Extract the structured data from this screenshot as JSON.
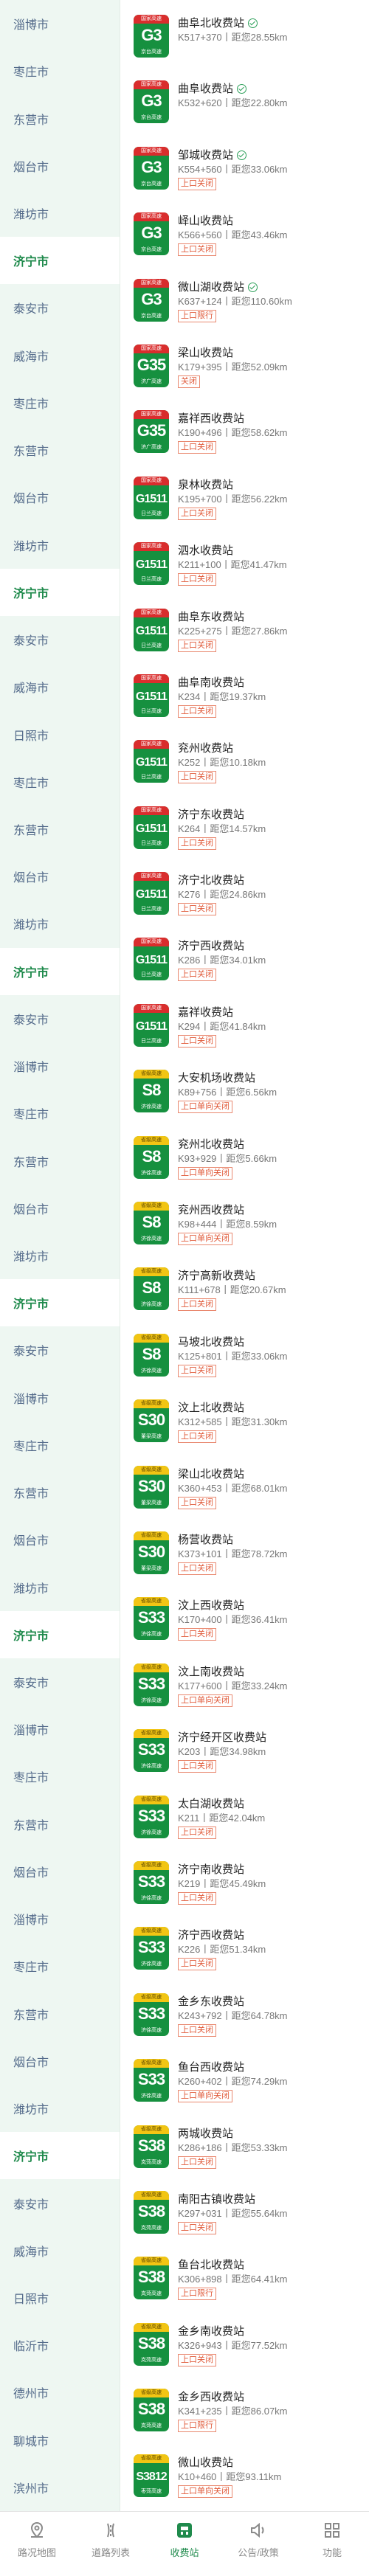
{
  "left_nav": [
    {
      "label": "淄博市",
      "selected": false
    },
    {
      "label": "枣庄市",
      "selected": false
    },
    {
      "label": "东营市",
      "selected": false
    },
    {
      "label": "烟台市",
      "selected": false
    },
    {
      "label": "潍坊市",
      "selected": false
    },
    {
      "label": "济宁市",
      "selected": true
    },
    {
      "label": "泰安市",
      "selected": false
    },
    {
      "label": "威海市",
      "selected": false
    },
    {
      "label": "枣庄市",
      "selected": false
    },
    {
      "label": "东营市",
      "selected": false
    },
    {
      "label": "烟台市",
      "selected": false
    },
    {
      "label": "潍坊市",
      "selected": false
    },
    {
      "label": "济宁市",
      "selected": true
    },
    {
      "label": "泰安市",
      "selected": false
    },
    {
      "label": "威海市",
      "selected": false
    },
    {
      "label": "日照市",
      "selected": false
    },
    {
      "label": "枣庄市",
      "selected": false
    },
    {
      "label": "东营市",
      "selected": false
    },
    {
      "label": "烟台市",
      "selected": false
    },
    {
      "label": "潍坊市",
      "selected": false
    },
    {
      "label": "济宁市",
      "selected": true
    },
    {
      "label": "泰安市",
      "selected": false
    },
    {
      "label": "淄博市",
      "selected": false
    },
    {
      "label": "枣庄市",
      "selected": false
    },
    {
      "label": "东营市",
      "selected": false
    },
    {
      "label": "烟台市",
      "selected": false
    },
    {
      "label": "潍坊市",
      "selected": false
    },
    {
      "label": "济宁市",
      "selected": true
    },
    {
      "label": "泰安市",
      "selected": false
    },
    {
      "label": "淄博市",
      "selected": false
    },
    {
      "label": "枣庄市",
      "selected": false
    },
    {
      "label": "东营市",
      "selected": false
    },
    {
      "label": "烟台市",
      "selected": false
    },
    {
      "label": "潍坊市",
      "selected": false
    },
    {
      "label": "济宁市",
      "selected": true
    },
    {
      "label": "泰安市",
      "selected": false
    },
    {
      "label": "淄博市",
      "selected": false
    },
    {
      "label": "枣庄市",
      "selected": false
    },
    {
      "label": "东营市",
      "selected": false
    },
    {
      "label": "烟台市",
      "selected": false
    },
    {
      "label": "淄博市",
      "selected": false
    },
    {
      "label": "枣庄市",
      "selected": false
    },
    {
      "label": "东营市",
      "selected": false
    },
    {
      "label": "烟台市",
      "selected": false
    },
    {
      "label": "潍坊市",
      "selected": false
    },
    {
      "label": "济宁市",
      "selected": true
    },
    {
      "label": "泰安市",
      "selected": false
    },
    {
      "label": "威海市",
      "selected": false
    },
    {
      "label": "日照市",
      "selected": false
    },
    {
      "label": "临沂市",
      "selected": false
    },
    {
      "label": "德州市",
      "selected": false
    },
    {
      "label": "聊城市",
      "selected": false
    },
    {
      "label": "滨州市",
      "selected": false
    }
  ],
  "stations": [
    {
      "road": "G3",
      "road_type": "national",
      "road_name": "京台高速",
      "name": "曲阜北收费站",
      "verified": true,
      "sub": "K517+370丨距您28.55km",
      "tag": ""
    },
    {
      "road": "G3",
      "road_type": "national",
      "road_name": "京台高速",
      "name": "曲阜收费站",
      "verified": true,
      "sub": "K532+620丨距您22.80km",
      "tag": ""
    },
    {
      "road": "G3",
      "road_type": "national",
      "road_name": "京台高速",
      "name": "邹城收费站",
      "verified": true,
      "sub": "K554+560丨距您33.06km",
      "tag": "上口关闭"
    },
    {
      "road": "G3",
      "road_type": "national",
      "road_name": "京台高速",
      "name": "峄山收费站",
      "verified": false,
      "sub": "K566+560丨距您43.46km",
      "tag": "上口关闭"
    },
    {
      "road": "G3",
      "road_type": "national",
      "road_name": "京台高速",
      "name": "微山湖收费站",
      "verified": true,
      "sub": "K637+124丨距您110.60km",
      "tag": "上口限行"
    },
    {
      "road": "G35",
      "road_type": "national",
      "road_name": "济广高速",
      "name": "梁山收费站",
      "verified": false,
      "sub": "K179+395丨距您52.09km",
      "tag": "关闭"
    },
    {
      "road": "G35",
      "road_type": "national",
      "road_name": "济广高速",
      "name": "嘉祥西收费站",
      "verified": false,
      "sub": "K190+496丨距您58.62km",
      "tag": "上口关闭"
    },
    {
      "road": "G1511",
      "road_type": "national",
      "road_name": "日兰高速",
      "name": "泉林收费站",
      "verified": false,
      "sub": "K195+700丨距您56.22km",
      "tag": "上口关闭"
    },
    {
      "road": "G1511",
      "road_type": "national",
      "road_name": "日兰高速",
      "name": "泗水收费站",
      "verified": false,
      "sub": "K211+100丨距您41.47km",
      "tag": "上口关闭"
    },
    {
      "road": "G1511",
      "road_type": "national",
      "road_name": "日兰高速",
      "name": "曲阜东收费站",
      "verified": false,
      "sub": "K225+275丨距您27.86km",
      "tag": "上口关闭"
    },
    {
      "road": "G1511",
      "road_type": "national",
      "road_name": "日兰高速",
      "name": "曲阜南收费站",
      "verified": false,
      "sub": "K234丨距您19.37km",
      "tag": "上口关闭"
    },
    {
      "road": "G1511",
      "road_type": "national",
      "road_name": "日兰高速",
      "name": "兖州收费站",
      "verified": false,
      "sub": "K252丨距您10.18km",
      "tag": "上口关闭"
    },
    {
      "road": "G1511",
      "road_type": "national",
      "road_name": "日兰高速",
      "name": "济宁东收费站",
      "verified": false,
      "sub": "K264丨距您14.57km",
      "tag": "上口关闭"
    },
    {
      "road": "G1511",
      "road_type": "national",
      "road_name": "日兰高速",
      "name": "济宁北收费站",
      "verified": false,
      "sub": "K276丨距您24.86km",
      "tag": "上口关闭"
    },
    {
      "road": "G1511",
      "road_type": "national",
      "road_name": "日兰高速",
      "name": "济宁西收费站",
      "verified": false,
      "sub": "K286丨距您34.01km",
      "tag": "上口关闭"
    },
    {
      "road": "G1511",
      "road_type": "national",
      "road_name": "日兰高速",
      "name": "嘉祥收费站",
      "verified": false,
      "sub": "K294丨距您41.84km",
      "tag": "上口关闭"
    },
    {
      "road": "S8",
      "road_type": "provincial",
      "road_name": "济徐高速",
      "name": "大安机场收费站",
      "verified": false,
      "sub": "K89+756丨距您6.56km",
      "tag": "上口单向关闭"
    },
    {
      "road": "S8",
      "road_type": "provincial",
      "road_name": "济徐高速",
      "name": "兖州北收费站",
      "verified": false,
      "sub": "K93+929丨距您5.66km",
      "tag": "上口单向关闭"
    },
    {
      "road": "S8",
      "road_type": "provincial",
      "road_name": "济徐高速",
      "name": "兖州西收费站",
      "verified": false,
      "sub": "K98+444丨距您8.59km",
      "tag": "上口单向关闭"
    },
    {
      "road": "S8",
      "road_type": "provincial",
      "road_name": "济徐高速",
      "name": "济宁高新收费站",
      "verified": false,
      "sub": "K111+678丨距您20.67km",
      "tag": "上口关闭"
    },
    {
      "road": "S8",
      "road_type": "provincial",
      "road_name": "济徐高速",
      "name": "马坡北收费站",
      "verified": false,
      "sub": "K125+801丨距您33.06km",
      "tag": "上口关闭"
    },
    {
      "road": "S30",
      "road_type": "provincial",
      "road_name": "董梁高速",
      "name": "汶上北收费站",
      "verified": false,
      "sub": "K312+585丨距您31.30km",
      "tag": "上口关闭"
    },
    {
      "road": "S30",
      "road_type": "provincial",
      "road_name": "董梁高速",
      "name": "梁山北收费站",
      "verified": false,
      "sub": "K360+453丨距您68.01km",
      "tag": "上口关闭"
    },
    {
      "road": "S30",
      "road_type": "provincial",
      "road_name": "董梁高速",
      "name": "杨营收费站",
      "verified": false,
      "sub": "K373+101丨距您78.72km",
      "tag": "上口关闭"
    },
    {
      "road": "S33",
      "road_type": "provincial",
      "road_name": "济徐高速",
      "name": "汶上西收费站",
      "verified": false,
      "sub": "K170+400丨距您36.41km",
      "tag": "上口关闭"
    },
    {
      "road": "S33",
      "road_type": "provincial",
      "road_name": "济徐高速",
      "name": "汶上南收费站",
      "verified": false,
      "sub": "K177+600丨距您33.24km",
      "tag": "上口单向关闭"
    },
    {
      "road": "S33",
      "road_type": "provincial",
      "road_name": "济徐高速",
      "name": "济宁经开区收费站",
      "verified": false,
      "sub": "K203丨距您34.98km",
      "tag": "上口关闭"
    },
    {
      "road": "S33",
      "road_type": "provincial",
      "road_name": "济徐高速",
      "name": "太白湖收费站",
      "verified": false,
      "sub": "K211丨距您42.04km",
      "tag": "上口关闭"
    },
    {
      "road": "S33",
      "road_type": "provincial",
      "road_name": "济徐高速",
      "name": "济宁南收费站",
      "verified": false,
      "sub": "K219丨距您45.49km",
      "tag": "上口关闭"
    },
    {
      "road": "S33",
      "road_type": "provincial",
      "road_name": "济徐高速",
      "name": "济宁西收费站",
      "verified": false,
      "sub": "K226丨距您51.34km",
      "tag": "上口关闭"
    },
    {
      "road": "S33",
      "road_type": "provincial",
      "road_name": "济徐高速",
      "name": "金乡东收费站",
      "verified": false,
      "sub": "K243+792丨距您64.78km",
      "tag": "上口关闭"
    },
    {
      "road": "S33",
      "road_type": "provincial",
      "road_name": "济徐高速",
      "name": "鱼台西收费站",
      "verified": false,
      "sub": "K260+402丨距您74.29km",
      "tag": "上口单向关闭"
    },
    {
      "road": "S38",
      "road_type": "provincial",
      "road_name": "岚菏高速",
      "name": "两城收费站",
      "verified": false,
      "sub": "K286+186丨距您53.33km",
      "tag": "上口关闭"
    },
    {
      "road": "S38",
      "road_type": "provincial",
      "road_name": "岚菏高速",
      "name": "南阳古镇收费站",
      "verified": false,
      "sub": "K297+031丨距您55.64km",
      "tag": "上口关闭"
    },
    {
      "road": "S38",
      "road_type": "provincial",
      "road_name": "岚菏高速",
      "name": "鱼台北收费站",
      "verified": false,
      "sub": "K306+898丨距您64.41km",
      "tag": "上口限行"
    },
    {
      "road": "S38",
      "road_type": "provincial",
      "road_name": "岚菏高速",
      "name": "金乡南收费站",
      "verified": false,
      "sub": "K326+943丨距您77.52km",
      "tag": "上口关闭"
    },
    {
      "road": "S38",
      "road_type": "provincial",
      "road_name": "岚菏高速",
      "name": "金乡西收费站",
      "verified": false,
      "sub": "K341+235丨距您86.07km",
      "tag": "上口限行"
    },
    {
      "road": "S3812",
      "road_type": "provincial",
      "road_name": "枣菏高速",
      "name": "微山收费站",
      "verified": false,
      "sub": "K10+460丨距您93.11km",
      "tag": "上口单向关闭"
    }
  ],
  "tabs": [
    {
      "label": "路况地图",
      "icon": "map-pin-icon",
      "active": false
    },
    {
      "label": "道路列表",
      "icon": "list-icon",
      "active": false
    },
    {
      "label": "收费站",
      "icon": "toll-station-icon",
      "active": true
    },
    {
      "label": "公告/政策",
      "icon": "speaker-icon",
      "active": false
    },
    {
      "label": "功能",
      "icon": "grid-icon",
      "active": false
    }
  ],
  "colors": {
    "accent": "#1f8a4c",
    "national_badge_top": "#d92d2d",
    "provincial_badge_top": "#f2c514",
    "badge_body": "#16903f",
    "tag": "#e05a3a"
  }
}
